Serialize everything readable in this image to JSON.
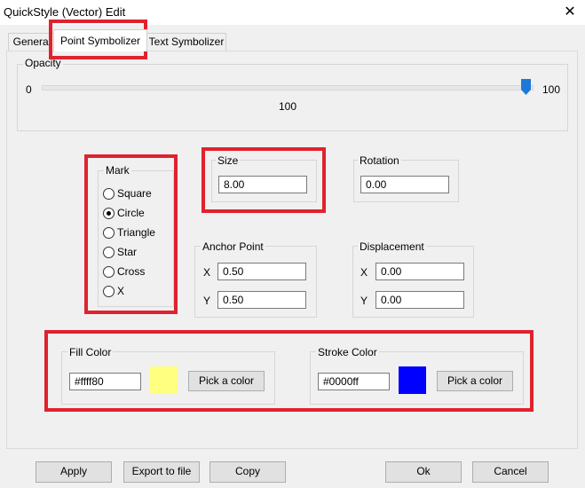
{
  "window": {
    "title": "QuickStyle (Vector) Edit",
    "close_glyph": "✕"
  },
  "tabs": [
    {
      "label": "General",
      "active": false
    },
    {
      "label": "Point Symbolizer",
      "active": true
    },
    {
      "label": "Text Symbolizer",
      "active": false
    }
  ],
  "opacity": {
    "label": "Opacity",
    "min_label": "0",
    "max_label": "100",
    "value_label": "100",
    "value": 100,
    "thumb_color": "#1e78d7"
  },
  "mark": {
    "label": "Mark",
    "options": [
      {
        "label": "Square",
        "checked": false
      },
      {
        "label": "Circle",
        "checked": true
      },
      {
        "label": "Triangle",
        "checked": false
      },
      {
        "label": "Star",
        "checked": false
      },
      {
        "label": "Cross",
        "checked": false
      },
      {
        "label": "X",
        "checked": false
      }
    ]
  },
  "size": {
    "label": "Size",
    "value": "8.00"
  },
  "rotation": {
    "label": "Rotation",
    "value": "0.00"
  },
  "anchor_point": {
    "label": "Anchor Point",
    "x_label": "X",
    "x_value": "0.50",
    "y_label": "Y",
    "y_value": "0.50"
  },
  "displacement": {
    "label": "Displacement",
    "x_label": "X",
    "x_value": "0.00",
    "y_label": "Y",
    "y_value": "0.00"
  },
  "fill_color": {
    "label": "Fill Color",
    "value": "#ffff80",
    "swatch": "#ffff80",
    "button": "Pick a color"
  },
  "stroke_color": {
    "label": "Stroke Color",
    "value": "#0000ff",
    "swatch": "#0000ff",
    "button": "Pick a color"
  },
  "buttons": {
    "apply": "Apply",
    "export": "Export to file",
    "copy": "Copy",
    "ok": "Ok",
    "cancel": "Cancel"
  },
  "highlight_color": "#e0222e"
}
